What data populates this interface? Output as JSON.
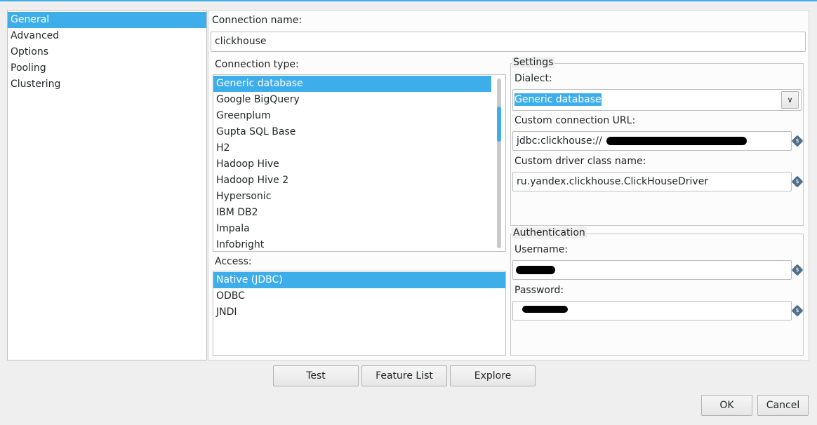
{
  "sidebar": {
    "items": [
      {
        "label": "General",
        "selected": true
      },
      {
        "label": "Advanced"
      },
      {
        "label": "Options"
      },
      {
        "label": "Pooling"
      },
      {
        "label": "Clustering"
      }
    ]
  },
  "connection_name": {
    "label": "Connection name:",
    "value": "clickhouse"
  },
  "connection_type": {
    "label": "Connection type:",
    "items": [
      "Generic database",
      "Google BigQuery",
      "Greenplum",
      "Gupta SQL Base",
      "H2",
      "Hadoop Hive",
      "Hadoop Hive 2",
      "Hypersonic",
      "IBM DB2",
      "Impala",
      "Infobright"
    ],
    "selected": "Generic database"
  },
  "access": {
    "label": "Access:",
    "items": [
      "Native (JDBC)",
      "ODBC",
      "JNDI"
    ],
    "selected": "Native (JDBC)"
  },
  "settings": {
    "title": "Settings",
    "dialect_label": "Dialect:",
    "dialect_value": "Generic database",
    "url_label": "Custom connection URL:",
    "url_value": "jdbc:clickhouse://",
    "driver_label": "Custom driver class name:",
    "driver_value": "ru.yandex.clickhouse.ClickHouseDriver"
  },
  "auth": {
    "title": "Authentication",
    "username_label": "Username:",
    "password_label": "Password:"
  },
  "buttons": {
    "test": "Test",
    "feature_list": "Feature List",
    "explore": "Explore",
    "ok": "OK",
    "cancel": "Cancel"
  },
  "colors": {
    "accent": "#3daee9",
    "variable_icon": "#4e6f8a"
  }
}
